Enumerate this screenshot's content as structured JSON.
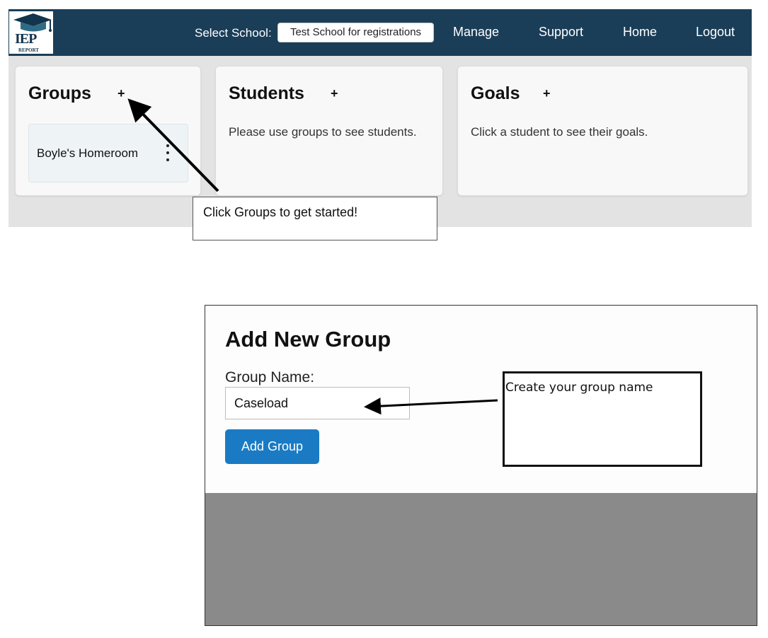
{
  "top_screenshot": {
    "logo": {
      "text": "IEP",
      "subtext": "REPORT"
    },
    "navbar": {
      "select_label": "Select School:",
      "selected_school": "Test School for registrations",
      "links": {
        "manage": "Manage",
        "support": "Support",
        "home": "Home",
        "logout": "Logout"
      },
      "bg_color": "#1b3e58"
    },
    "groups_card": {
      "title": "Groups",
      "add": "+",
      "items": [
        {
          "name": "Boyle's Homeroom"
        }
      ]
    },
    "students_card": {
      "title": "Students",
      "add": "+",
      "message": "Please use groups to see students."
    },
    "goals_card": {
      "title": "Goals",
      "add": "+",
      "message": "Click a student to see their goals."
    },
    "callout": "Click Groups to get started!"
  },
  "bottom_screenshot": {
    "modal_title": "Add New Group",
    "field_label": "Group Name:",
    "field_value": "Caseload",
    "button_label": "Add Group",
    "button_color": "#1a7bc4",
    "callout": "Create your group name"
  }
}
